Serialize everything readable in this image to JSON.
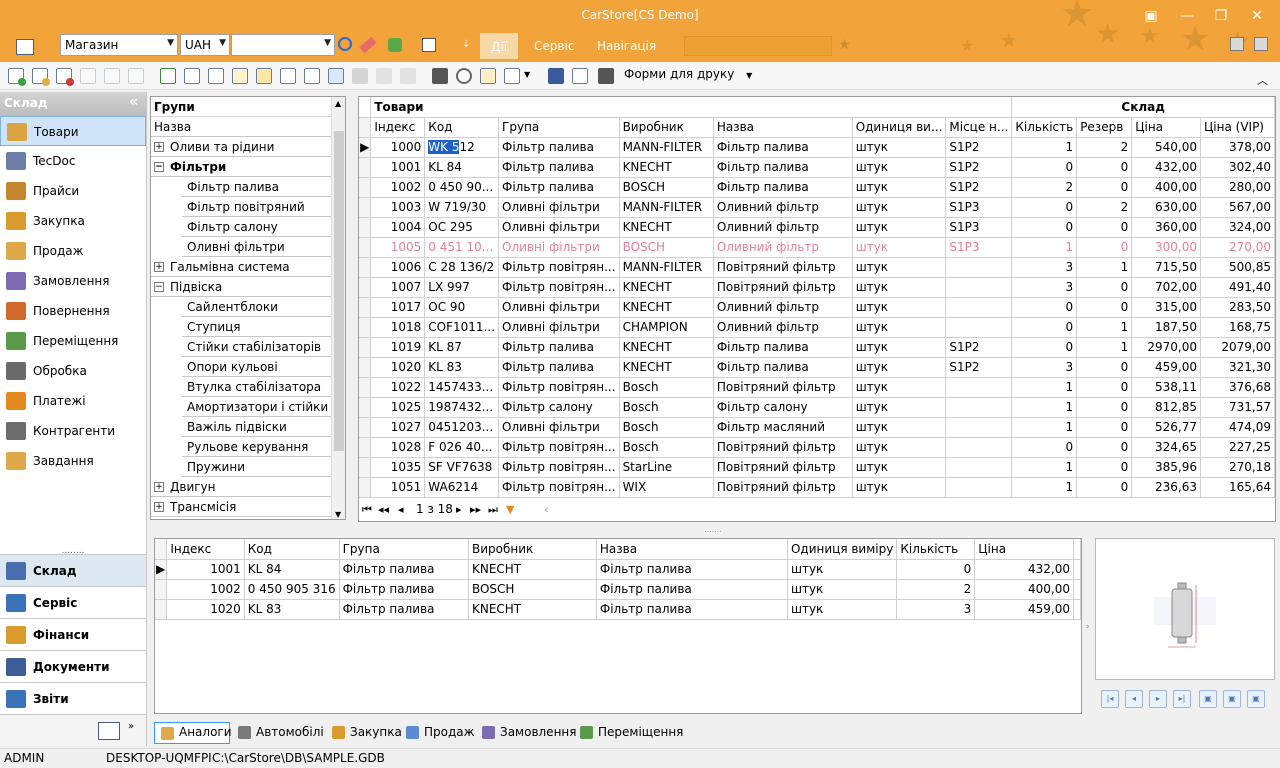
{
  "window": {
    "title": "CarStore[CS Demo]",
    "accent": "#f2a33a"
  },
  "ribbon": {
    "store_combo": "Магазин",
    "currency_combo": "UAH",
    "empty_combo": "",
    "tabs": [
      "Дії",
      "Сервіс",
      "Навігація"
    ]
  },
  "toolbar": {
    "print_forms": "Форми для друку"
  },
  "nav": {
    "header": "Склад",
    "items": [
      {
        "label": "Товари",
        "icon": "box-icon"
      },
      {
        "label": "TecDoc",
        "icon": "catalog-icon"
      },
      {
        "label": "Прайси",
        "icon": "price-list-icon"
      },
      {
        "label": "Закупка",
        "icon": "purchase-icon"
      },
      {
        "label": "Продаж",
        "icon": "sale-icon"
      },
      {
        "label": "Замовлення",
        "icon": "order-icon"
      },
      {
        "label": "Повернення",
        "icon": "return-icon"
      },
      {
        "label": "Переміщення",
        "icon": "transfer-icon"
      },
      {
        "label": "Обробка",
        "icon": "processing-icon"
      },
      {
        "label": "Платежі",
        "icon": "payment-icon"
      },
      {
        "label": "Контрагенти",
        "icon": "contractor-icon"
      },
      {
        "label": "Завдання",
        "icon": "task-icon"
      }
    ],
    "sections": [
      "Склад",
      "Сервіс",
      "Фінанси",
      "Документи",
      "Звіти"
    ]
  },
  "groups": {
    "header": "Групи",
    "column": "Назва",
    "nodes": [
      {
        "label": "Оливи та рідини",
        "level": 0,
        "exp": "+"
      },
      {
        "label": "Фільтри",
        "level": 0,
        "exp": "-",
        "bold": true
      },
      {
        "label": "Фільтр палива",
        "level": 1
      },
      {
        "label": "Фільтр повітряний",
        "level": 1
      },
      {
        "label": "Фільтр салону",
        "level": 1
      },
      {
        "label": "Оливні фільтри",
        "level": 1
      },
      {
        "label": "Гальмівна система",
        "level": 0,
        "exp": "+"
      },
      {
        "label": "Підвіска",
        "level": 0,
        "exp": "-"
      },
      {
        "label": "Сайлентблоки",
        "level": 1
      },
      {
        "label": "Ступиця",
        "level": 1
      },
      {
        "label": "Стійки стабілізаторів",
        "level": 1
      },
      {
        "label": "Опори кульові",
        "level": 1
      },
      {
        "label": "Втулка стабілізатора",
        "level": 1
      },
      {
        "label": "Амортизатори і стійки ...",
        "level": 1
      },
      {
        "label": "Важіль підвіски",
        "level": 1
      },
      {
        "label": "Рульове керування",
        "level": 1,
        "exp": "+"
      },
      {
        "label": "Пружини",
        "level": 1
      },
      {
        "label": "Двигун",
        "level": 0,
        "exp": "+"
      },
      {
        "label": "Трансмісія",
        "level": 0,
        "exp": "+"
      }
    ]
  },
  "goods": {
    "band_left": "Товари",
    "band_right": "Склад",
    "columns": [
      "Індекс",
      "Код",
      "Група",
      "Виробник",
      "Назва",
      "Одиниця ви...",
      "Місце н...",
      "Кількість",
      "Резерв",
      "Ціна",
      "Ціна (VIP)"
    ],
    "rows": [
      [
        "1000",
        "WK 512",
        "Фільтр палива",
        "MANN-FILTER",
        "Фільтр палива",
        "штук",
        "S1P2",
        "1",
        "2",
        "540,00",
        "378,00"
      ],
      [
        "1001",
        "KL 84",
        "Фільтр палива",
        "KNECHT",
        "Фільтр палива",
        "штук",
        "S1P2",
        "0",
        "0",
        "432,00",
        "302,40"
      ],
      [
        "1002",
        "0 450 90...",
        "Фільтр палива",
        "BOSCH",
        "Фільтр палива",
        "штук",
        "S1P2",
        "2",
        "0",
        "400,00",
        "280,00"
      ],
      [
        "1003",
        "W 719/30",
        "Оливні фільтри",
        "MANN-FILTER",
        "Оливний фільтр",
        "штук",
        "S1P3",
        "0",
        "2",
        "630,00",
        "567,00"
      ],
      [
        "1004",
        "OC 295",
        "Оливні фільтри",
        "KNECHT",
        "Оливний фільтр",
        "штук",
        "S1P3",
        "0",
        "0",
        "360,00",
        "324,00"
      ],
      [
        "1005",
        "0 451 10...",
        "Оливні фільтри",
        "BOSCH",
        "Оливний фільтр",
        "штук",
        "S1P3",
        "1",
        "0",
        "300,00",
        "270,00"
      ],
      [
        "1006",
        "C 28 136/2",
        "Фільтр повітрян...",
        "MANN-FILTER",
        "Повітряний фільтр",
        "штук",
        "",
        "3",
        "1",
        "715,50",
        "500,85"
      ],
      [
        "1007",
        "LX 997",
        "Фільтр повітрян...",
        "KNECHT",
        "Повітряний фільтр",
        "штук",
        "",
        "3",
        "0",
        "702,00",
        "491,40"
      ],
      [
        "1017",
        "OC 90",
        "Оливні фільтри",
        "KNECHT",
        "Оливний фільтр",
        "штук",
        "",
        "0",
        "0",
        "315,00",
        "283,50"
      ],
      [
        "1018",
        "COF1011...",
        "Оливні фільтри",
        "CHAMPION",
        "Оливний фільтр",
        "штук",
        "",
        "0",
        "1",
        "187,50",
        "168,75"
      ],
      [
        "1019",
        "KL 87",
        "Фільтр палива",
        "KNECHT",
        "Фільтр палива",
        "штук",
        "S1P2",
        "0",
        "1",
        "2970,00",
        "2079,00"
      ],
      [
        "1020",
        "KL 83",
        "Фільтр палива",
        "KNECHT",
        "Фільтр палива",
        "штук",
        "S1P2",
        "3",
        "0",
        "459,00",
        "321,30"
      ],
      [
        "1022",
        "1457433...",
        "Фільтр повітрян...",
        "Bosch",
        "Повітряний фільтр",
        "штук",
        "",
        "1",
        "0",
        "538,11",
        "376,68"
      ],
      [
        "1025",
        "1987432...",
        "Фільтр салону",
        "Bosch",
        "Фільтр салону",
        "штук",
        "",
        "1",
        "0",
        "812,85",
        "731,57"
      ],
      [
        "1027",
        "0451203...",
        "Оливні фільтри",
        "Bosch",
        "Фільтр масляний",
        "штук",
        "",
        "1",
        "0",
        "526,77",
        "474,09"
      ],
      [
        "1028",
        "F 026 40...",
        "Фільтр повітрян...",
        "Bosch",
        "Повітряний фільтр",
        "штук",
        "",
        "0",
        "0",
        "324,65",
        "227,25"
      ],
      [
        "1035",
        "SF VF7638",
        "Фільтр повітрян...",
        "StarLine",
        "Повітряний фільтр",
        "штук",
        "",
        "1",
        "0",
        "385,96",
        "270,18"
      ],
      [
        "1051",
        "WA6214",
        "Фільтр повітрян...",
        "WIX",
        "Повітряний фільтр",
        "штук",
        "",
        "1",
        "0",
        "236,63",
        "165,64"
      ]
    ],
    "pager": "1 з 18"
  },
  "analogs": {
    "columns": [
      "Індекс",
      "Код",
      "Група",
      "Виробник",
      "Назва",
      "Одиниця виміру",
      "Кількість",
      "Ціна"
    ],
    "rows": [
      [
        "1001",
        "KL 84",
        "Фільтр палива",
        "KNECHT",
        "Фільтр палива",
        "штук",
        "0",
        "432,00"
      ],
      [
        "1002",
        "0 450 905 316",
        "Фільтр палива",
        "BOSCH",
        "Фільтр палива",
        "штук",
        "2",
        "400,00"
      ],
      [
        "1020",
        "KL 83",
        "Фільтр палива",
        "KNECHT",
        "Фільтр палива",
        "штук",
        "3",
        "459,00"
      ]
    ]
  },
  "bottom_tabs": [
    "Аналоги",
    "Автомобілі",
    "Закупка",
    "Продаж",
    "Замовлення",
    "Переміщення"
  ],
  "status": {
    "user": "ADMIN",
    "host": "DESKTOP-UQMFPI",
    "db": "C:\\CarStore\\DB\\SAMPLE.GDB"
  }
}
